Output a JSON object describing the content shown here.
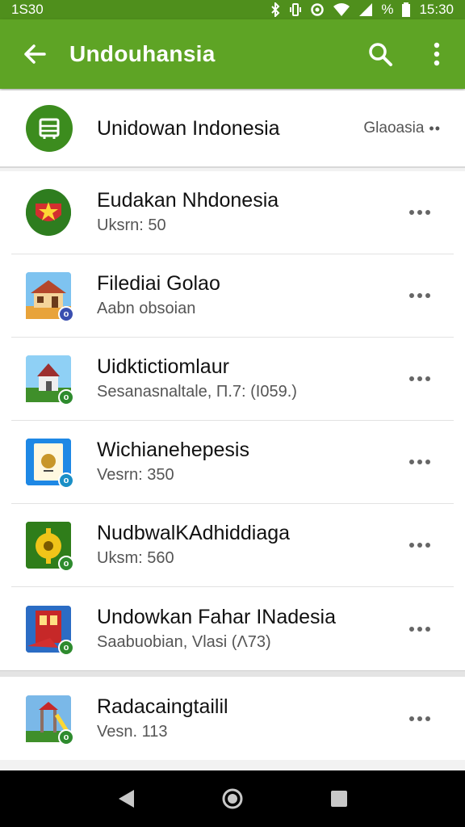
{
  "status_bar": {
    "time_left": "1S30",
    "battery": "%",
    "time_right": "15:30"
  },
  "app_bar": {
    "title": "Undouhansia"
  },
  "header": {
    "title": "Unidowan Indonesia",
    "right_label": "Glaoasia"
  },
  "items": [
    {
      "title": "Eudakan Nhdonesia",
      "subtitle": "Uksrn: 50",
      "icon": "flag-emblem-icon",
      "accent": "#2e7d1f"
    },
    {
      "title": "Filediai Golao",
      "subtitle": "Aabn obsoian",
      "icon": "house-icon",
      "accent": "#3a4fb0"
    },
    {
      "title": "Uidktictiomlaur",
      "subtitle": "Sesanasnaltale, Π.7: (I059.)",
      "icon": "cottage-icon",
      "accent": "#2e8b2e"
    },
    {
      "title": "Wichianehepesis",
      "subtitle": "Vesrn: 350",
      "icon": "card-icon",
      "accent": "#1a8fc6"
    },
    {
      "title": "NudbwalKAdhiddiaga",
      "subtitle": "Uksm: 560",
      "icon": "gear-fruit-icon",
      "accent": "#2e8b2e"
    },
    {
      "title": "Undowkan Fahar INadesia",
      "subtitle": "Saabuobian, Vlasi (Λ73)",
      "icon": "building-icon",
      "accent": "#2e8b2e"
    },
    {
      "title": "Radacaingtailil",
      "subtitle": "Vesn. 113",
      "icon": "playground-icon",
      "accent": "#2e8b2e"
    }
  ]
}
